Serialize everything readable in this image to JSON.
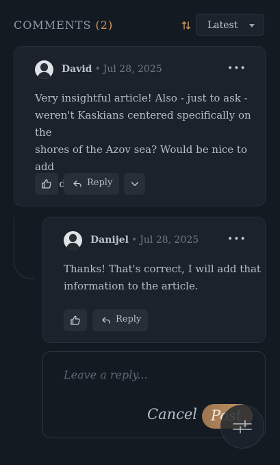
{
  "header": {
    "title": "COMMENTS",
    "count": "(2)",
    "sort_icon": "sort-arrows-icon",
    "sort_value": "Latest"
  },
  "comments": [
    {
      "author": "David",
      "date": "Jul 28, 2025",
      "text_lines": [
        "Very insightful article! Also - just to ask -",
        "weren't Kaskians centered specifically on the",
        "shores of the Azov sea? Would be nice to add",
        "that detail."
      ],
      "reply_label": "Reply",
      "more_label": "•••"
    },
    {
      "author": "Danijel",
      "date": "Jul 28, 2025",
      "text_lines": [
        "Thanks! That's correct, I will add that",
        "information to the article."
      ],
      "reply_label": "Reply",
      "more_label": "•••"
    }
  ],
  "composer": {
    "placeholder": "Leave a reply...",
    "cancel_label": "Cancel",
    "post_label": "Post"
  },
  "colors": {
    "background": "#131a22",
    "card": "#1b222b",
    "accent": "#d19a58",
    "post_gradient": "#b8885d"
  },
  "icons": [
    "sort-arrows-icon",
    "thumbs-up-icon",
    "reply-arrow-icon",
    "chevron-down-icon",
    "more-dots-icon",
    "settings-sliders-icon"
  ]
}
